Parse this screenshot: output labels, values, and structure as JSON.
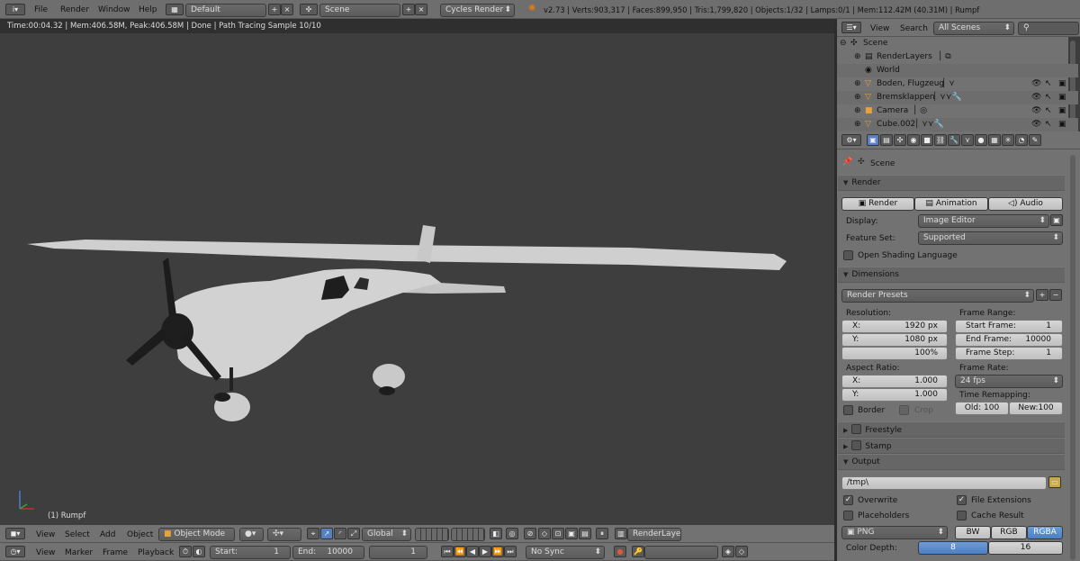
{
  "topbar": {
    "menus": [
      "File",
      "Render",
      "Window",
      "Help"
    ],
    "layout_name": "Default",
    "scene_name": "Scene",
    "engine": "Cycles Render",
    "stats": "v2.73 | Verts:903,317 | Faces:899,950 | Tris:1,799,820 | Objects:1/32 | Lamps:0/1 | Mem:112.42M (40.31M) | Rumpf"
  },
  "viewport": {
    "render_info": "Time:00:04.32 | Mem:406.58M, Peak:406.58M | Done | Path Tracing Sample 10/10",
    "object_label": "(1) Rumpf"
  },
  "view3d_header": {
    "menus": [
      "View",
      "Select",
      "Add",
      "Object"
    ],
    "mode": "Object Mode",
    "orientation": "Global",
    "render_layer": "RenderLayer"
  },
  "timeline": {
    "menus": [
      "View",
      "Marker",
      "Frame",
      "Playback"
    ],
    "start_label": "Start:",
    "start_value": "1",
    "end_label": "End:",
    "end_value": "10000",
    "current": "1",
    "sync": "No Sync"
  },
  "outliner": {
    "menus": [
      "View",
      "Search"
    ],
    "filter": "All Scenes",
    "items": [
      {
        "label": "Scene"
      },
      {
        "label": "RenderLayers"
      },
      {
        "label": "World"
      },
      {
        "label": "Boden, Flugzeug"
      },
      {
        "label": "Bremsklappen"
      },
      {
        "label": "Camera"
      },
      {
        "label": "Cube.002"
      }
    ]
  },
  "properties": {
    "context": "Scene",
    "render": {
      "title": "Render",
      "buttons": [
        "Render",
        "Animation",
        "Audio"
      ],
      "display_label": "Display:",
      "display_value": "Image Editor",
      "featureset_label": "Feature Set:",
      "featureset_value": "Supported",
      "osl_label": "Open Shading Language"
    },
    "dimensions": {
      "title": "Dimensions",
      "presets": "Render Presets",
      "resolution_label": "Resolution:",
      "res_x_label": "X:",
      "res_x": "1920 px",
      "res_y_label": "Y:",
      "res_y": "1080 px",
      "res_pct": "100%",
      "frame_range_label": "Frame Range:",
      "start_label": "Start Frame:",
      "start": "1",
      "end_label": "End Frame:",
      "end": "10000",
      "step_label": "Frame Step:",
      "step": "1",
      "aspect_label": "Aspect Ratio:",
      "asp_x_label": "X:",
      "asp_x": "1.000",
      "asp_y_label": "Y:",
      "asp_y": "1.000",
      "framerate_label": "Frame Rate:",
      "fps": "24 fps",
      "remap_label": "Time Remapping:",
      "old": "Old: 100",
      "new": "New:100",
      "border_label": "Border",
      "crop_label": "Crop"
    },
    "freestyle": "Freestyle",
    "stamp": "Stamp",
    "output": {
      "title": "Output",
      "path": "/tmp\\",
      "overwrite": "Overwrite",
      "file_ext": "File Extensions",
      "placeholders": "Placeholders",
      "cache": "Cache Result",
      "format": "PNG",
      "bw": "BW",
      "rgb": "RGB",
      "rgba": "RGBA",
      "depth_label": "Color Depth:",
      "depth_8": "8",
      "depth_16": "16"
    }
  }
}
